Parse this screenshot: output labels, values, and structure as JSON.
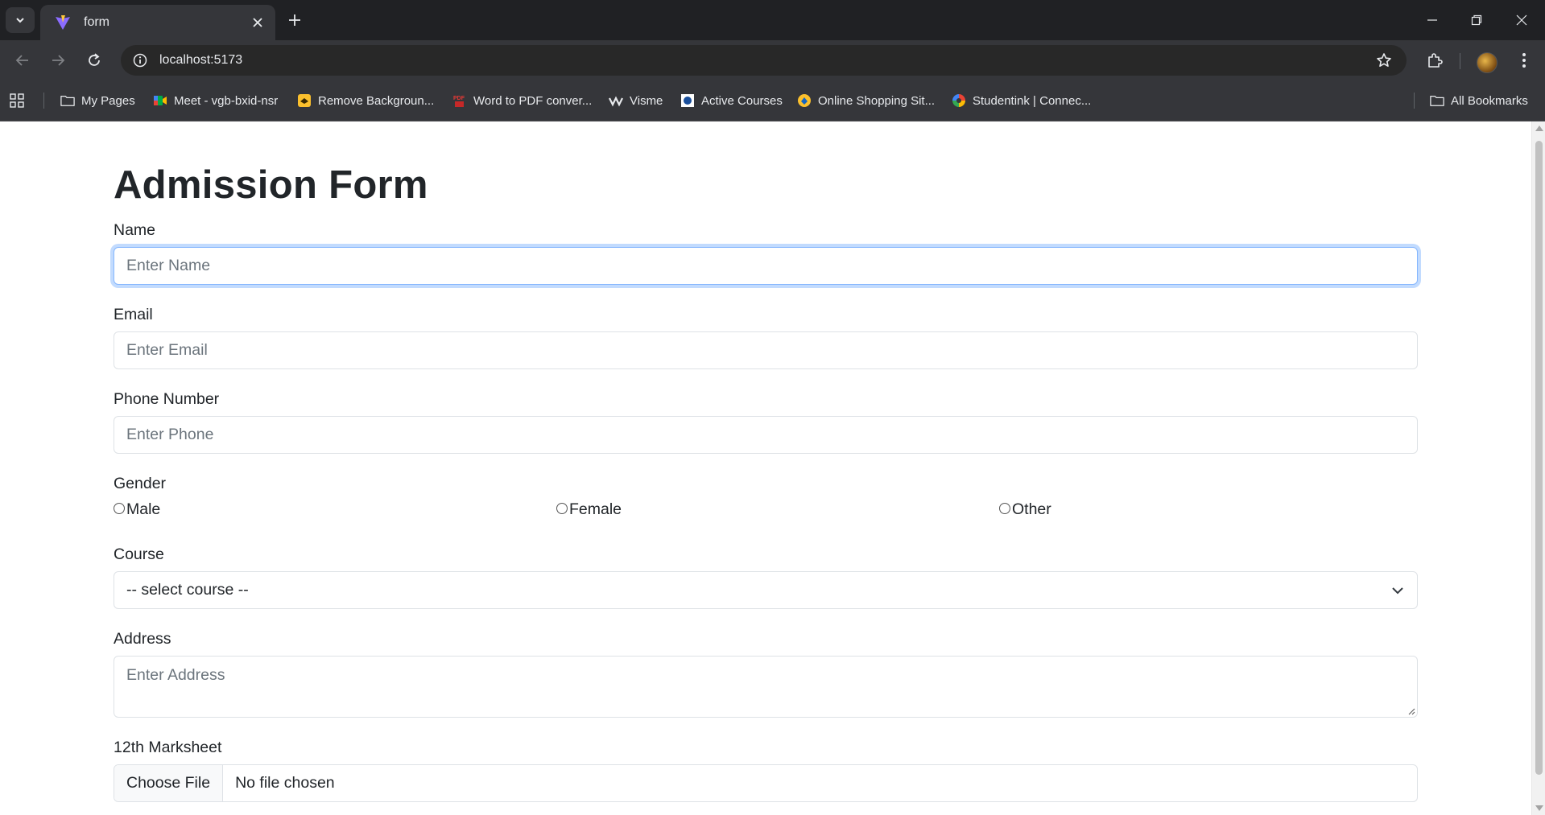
{
  "browser": {
    "tab_title": "form",
    "url": "localhost:5173",
    "bookmarks": [
      {
        "label": "My Pages",
        "icon": "folder-icon"
      },
      {
        "label": "Meet - vgb-bxid-nsr",
        "icon": "meet-icon"
      },
      {
        "label": "Remove Backgroun...",
        "icon": "remove-bg-icon"
      },
      {
        "label": "Word to PDF conver...",
        "icon": "pdf-icon"
      },
      {
        "label": "Visme",
        "icon": "visme-icon"
      },
      {
        "label": "Active Courses",
        "icon": "courses-icon"
      },
      {
        "label": "Online Shopping Sit...",
        "icon": "shopping-icon"
      },
      {
        "label": "Studentink | Connec...",
        "icon": "studentink-icon"
      }
    ],
    "all_bookmarks_label": "All Bookmarks"
  },
  "form": {
    "title": "Admission Form",
    "name": {
      "label": "Name",
      "placeholder": "Enter Name"
    },
    "email": {
      "label": "Email",
      "placeholder": "Enter Email"
    },
    "phone": {
      "label": "Phone Number",
      "placeholder": "Enter Phone"
    },
    "gender": {
      "label": "Gender",
      "options": [
        "Male",
        "Female",
        "Other"
      ]
    },
    "course": {
      "label": "Course",
      "selected": "-- select course --"
    },
    "address": {
      "label": "Address",
      "placeholder": "Enter Address"
    },
    "marksheet": {
      "label": "12th Marksheet",
      "button": "Choose File",
      "status": "No file chosen"
    }
  },
  "colors": {
    "focus_border": "#86b7fe",
    "text": "#212529",
    "placeholder": "#6c757d",
    "chrome_bg": "#202124",
    "toolbar_bg": "#35363a"
  }
}
